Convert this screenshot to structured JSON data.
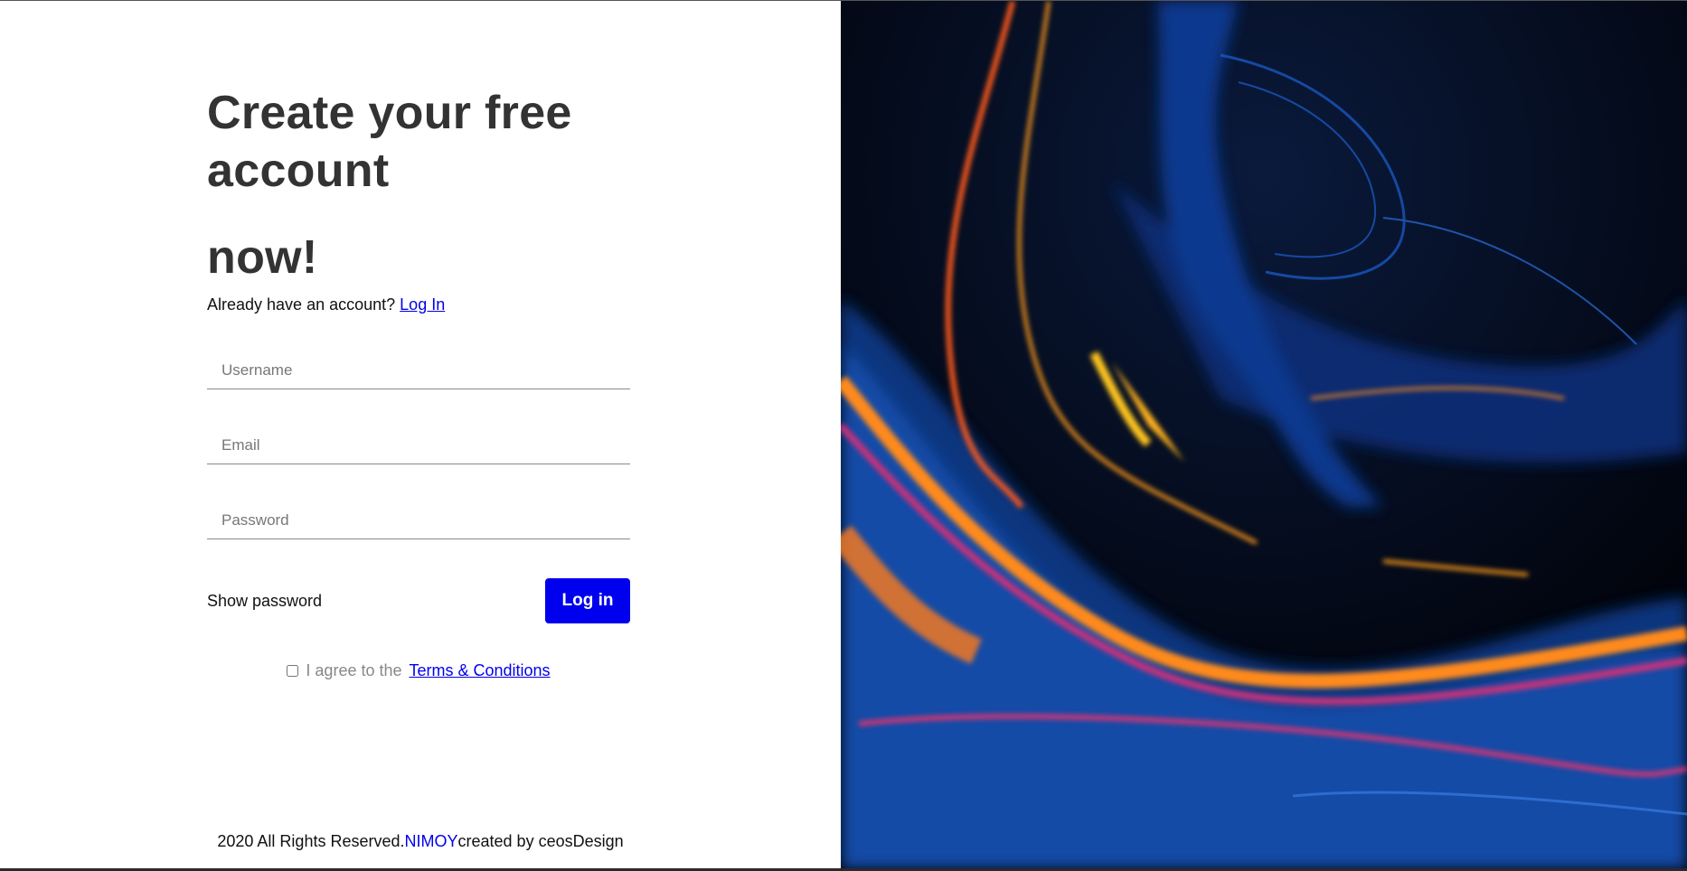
{
  "heading": {
    "line1": "Create your free",
    "line2": "account",
    "line3": "now!"
  },
  "login_prompt": {
    "text": "Already have an account?",
    "link": "Log In"
  },
  "fields": {
    "username_placeholder": "Username",
    "email_placeholder": "Email",
    "password_placeholder": "Password"
  },
  "actions": {
    "show_password": "Show password",
    "login_button": "Log in"
  },
  "terms": {
    "text": "I agree to the",
    "link": "Terms & Conditions"
  },
  "footer": {
    "prefix": "2020 All Rights Reserved.",
    "brand": "NIMOY",
    "suffix": "created by ceosDesign"
  },
  "colors": {
    "accent": "#0000ee",
    "heading": "#333333",
    "art_background": "#01030a"
  }
}
